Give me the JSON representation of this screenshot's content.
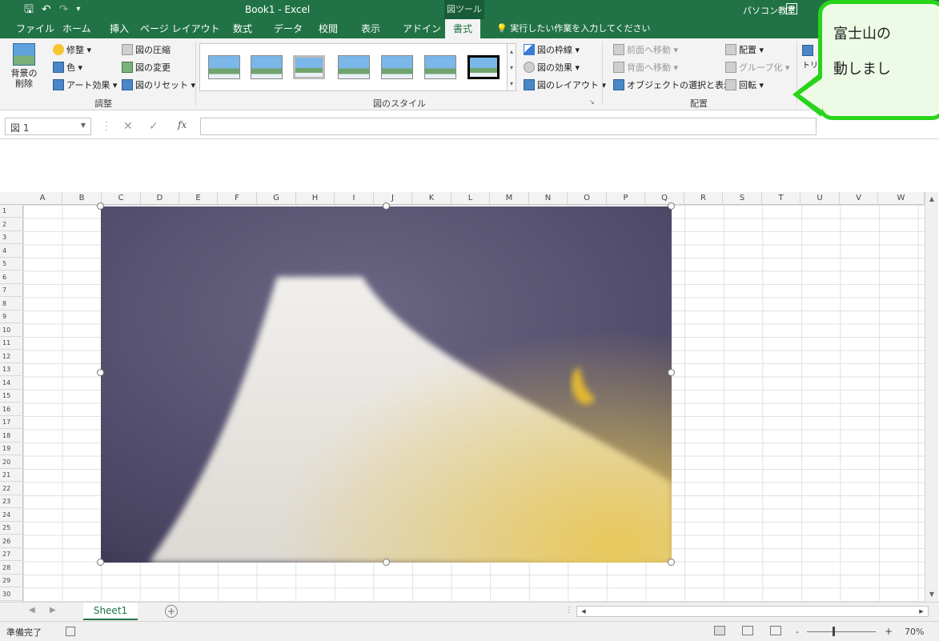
{
  "title_bar": {
    "save_icon": "save-icon",
    "undo_icon": "undo-icon",
    "redo_icon": "redo-icon",
    "customize_icon": "customize-qat-icon",
    "document_title": "Book1 - Excel",
    "tool_tab_title": "図ツール",
    "account_name": "パソコン教室",
    "ribbon_display_icon": "ribbon-display-options-icon"
  },
  "tabs": {
    "items": [
      "ファイル",
      "ホーム",
      "挿入",
      "ページ レイアウト",
      "数式",
      "データ",
      "校閲",
      "表示",
      "アドイン",
      "書式"
    ],
    "active": "書式",
    "tell_me": "実行したい作業を入力してください"
  },
  "ribbon": {
    "adjust_group": {
      "remove_background": "背景の\n削除",
      "corrections": "修整 ▾",
      "color": "色 ▾",
      "artistic_effects": "アート効果 ▾",
      "compress": "図の圧縮",
      "change_picture": "図の変更",
      "reset_picture": "図のリセット ▾",
      "label": "調整"
    },
    "styles_group": {
      "border": "図の枠線 ▾",
      "effects": "図の効果 ▾",
      "layout": "図のレイアウト ▾",
      "label": "図のスタイル",
      "selected_thumb_index": 7
    },
    "arrange_group": {
      "bring_forward": "前面へ移動 ▾",
      "send_backward": "背面へ移動 ▾",
      "selection_pane": "オブジェクトの選択と表示",
      "align": "配置 ▾",
      "group": "グループ化 ▾",
      "rotate": "回転 ▾",
      "label": "配置"
    },
    "size_group": {
      "crop": "トリミン"
    }
  },
  "callout": {
    "text_line1": "富士山の",
    "text_line2": "動しまし"
  },
  "formula_bar": {
    "name_box": "図 1",
    "fx_label": "fx",
    "formula_value": ""
  },
  "grid": {
    "columns": [
      "A",
      "B",
      "C",
      "D",
      "E",
      "F",
      "G",
      "H",
      "I",
      "J",
      "K",
      "L",
      "M",
      "N",
      "O",
      "P",
      "Q",
      "R",
      "S",
      "T",
      "U",
      "V",
      "W"
    ],
    "rows": [
      "1",
      "2",
      "3",
      "4",
      "5",
      "6",
      "7",
      "8",
      "9",
      "10",
      "11",
      "12",
      "13",
      "14",
      "15",
      "16",
      "17",
      "18",
      "19",
      "20",
      "21",
      "22",
      "23",
      "24",
      "25",
      "26",
      "27",
      "28",
      "29",
      "30"
    ]
  },
  "picture": {
    "description_icon": "mount-fuji-picture",
    "colors": {
      "sky": "#4e4a68",
      "mountain": "#e9e7e3",
      "moon": "#e2b830",
      "glow": "#e8c85a"
    }
  },
  "sheet_bar": {
    "sheet_name": "Sheet1",
    "add_sheet_icon": "add-sheet-icon"
  },
  "status_bar": {
    "status_text": "準備完了",
    "zoom_minus": "-",
    "zoom_plus": "+",
    "zoom_level": "70%"
  },
  "colors": {
    "excel_green": "#217346",
    "callout_border": "#28d41a",
    "callout_fill": "#edfbe6"
  }
}
